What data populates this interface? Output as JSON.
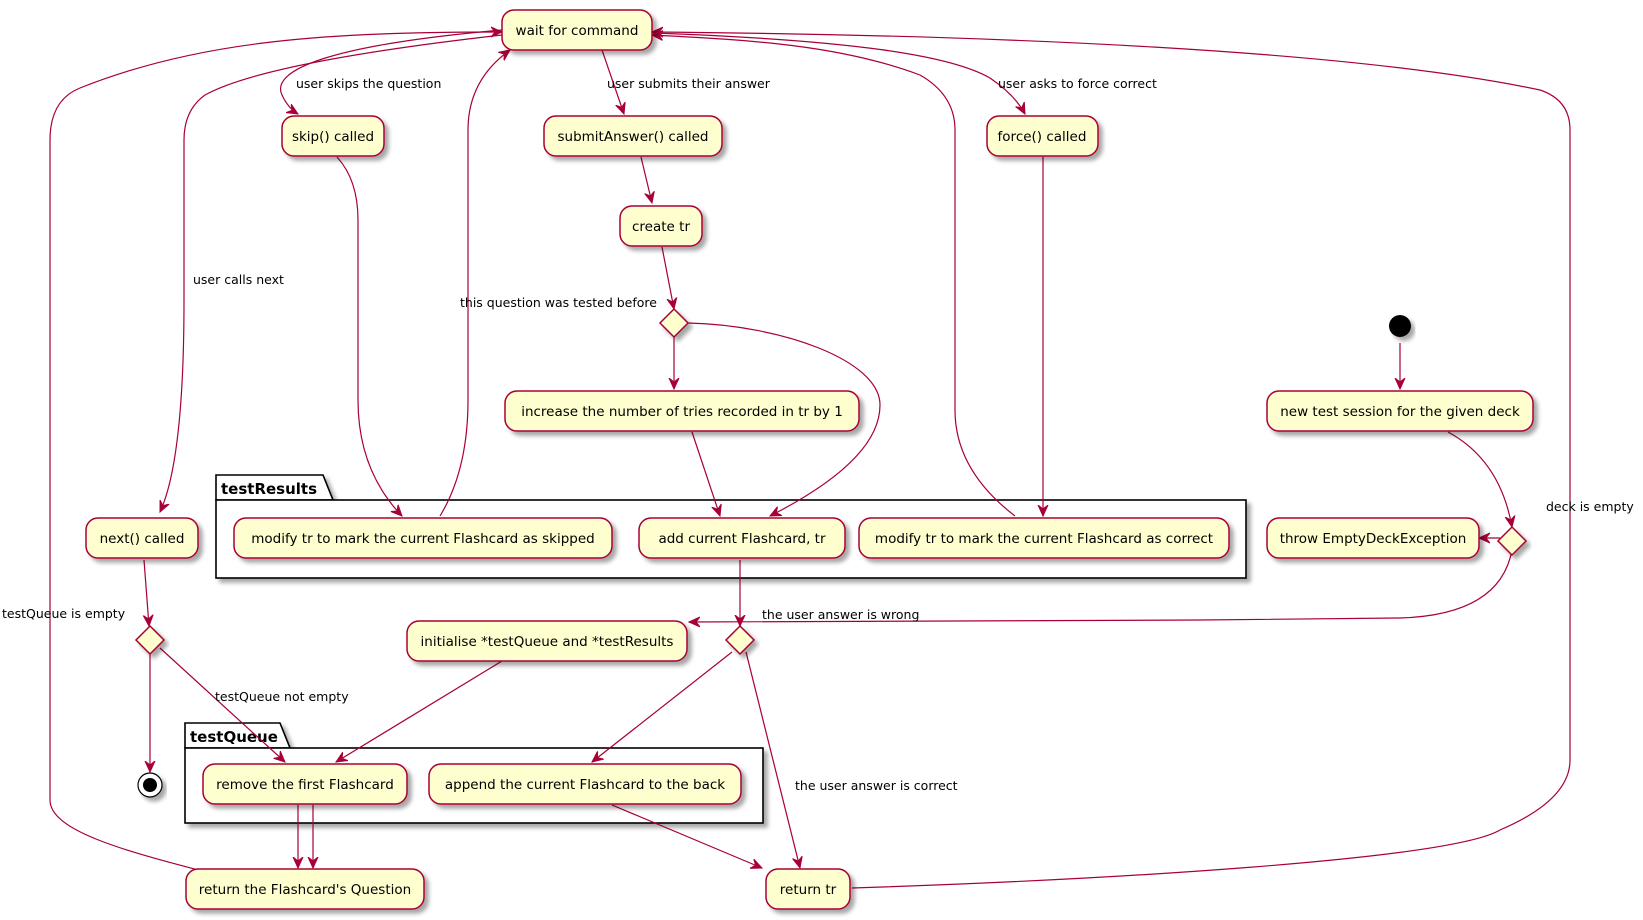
{
  "diagram": {
    "type": "UML activity diagram",
    "colors": {
      "node_fill": "#FEFECE",
      "node_border": "#A80036",
      "edge": "#A80036",
      "package_border": "#000000",
      "background": "#FFFFFF"
    },
    "nodes": {
      "wait": "wait for command",
      "skip": "skip() called",
      "submit": "submitAnswer() called",
      "force": "force() called",
      "create_tr": "create tr",
      "increase": "increase the number of tries recorded in tr by 1",
      "new_session": "new test session for the given deck",
      "next": "next() called",
      "mark_skipped": "modify tr to mark the current Flashcard as skipped",
      "add_current": "add current Flashcard, tr",
      "mark_correct": "modify tr to mark the current Flashcard as correct",
      "throw_empty": "throw EmptyDeckException",
      "initialise": "initialise *testQueue and *testResults",
      "remove_first": "remove the first Flashcard",
      "append_back": "append the current Flashcard to the back",
      "return_question": "return the Flashcard's Question",
      "return_tr": "return tr"
    },
    "packages": {
      "testResults": "testResults",
      "testQueue": "testQueue"
    },
    "edge_labels": {
      "skips": "user skips the question",
      "submits": "user submits their answer",
      "force_correct": "user asks to force correct",
      "calls_next": "user calls next",
      "tested_before": "this question was tested before",
      "deck_empty": "deck is empty",
      "queue_empty": "testQueue is empty",
      "queue_not_empty": "testQueue not empty",
      "answer_wrong": "the user answer is wrong",
      "answer_correct": "the user answer is correct"
    }
  }
}
